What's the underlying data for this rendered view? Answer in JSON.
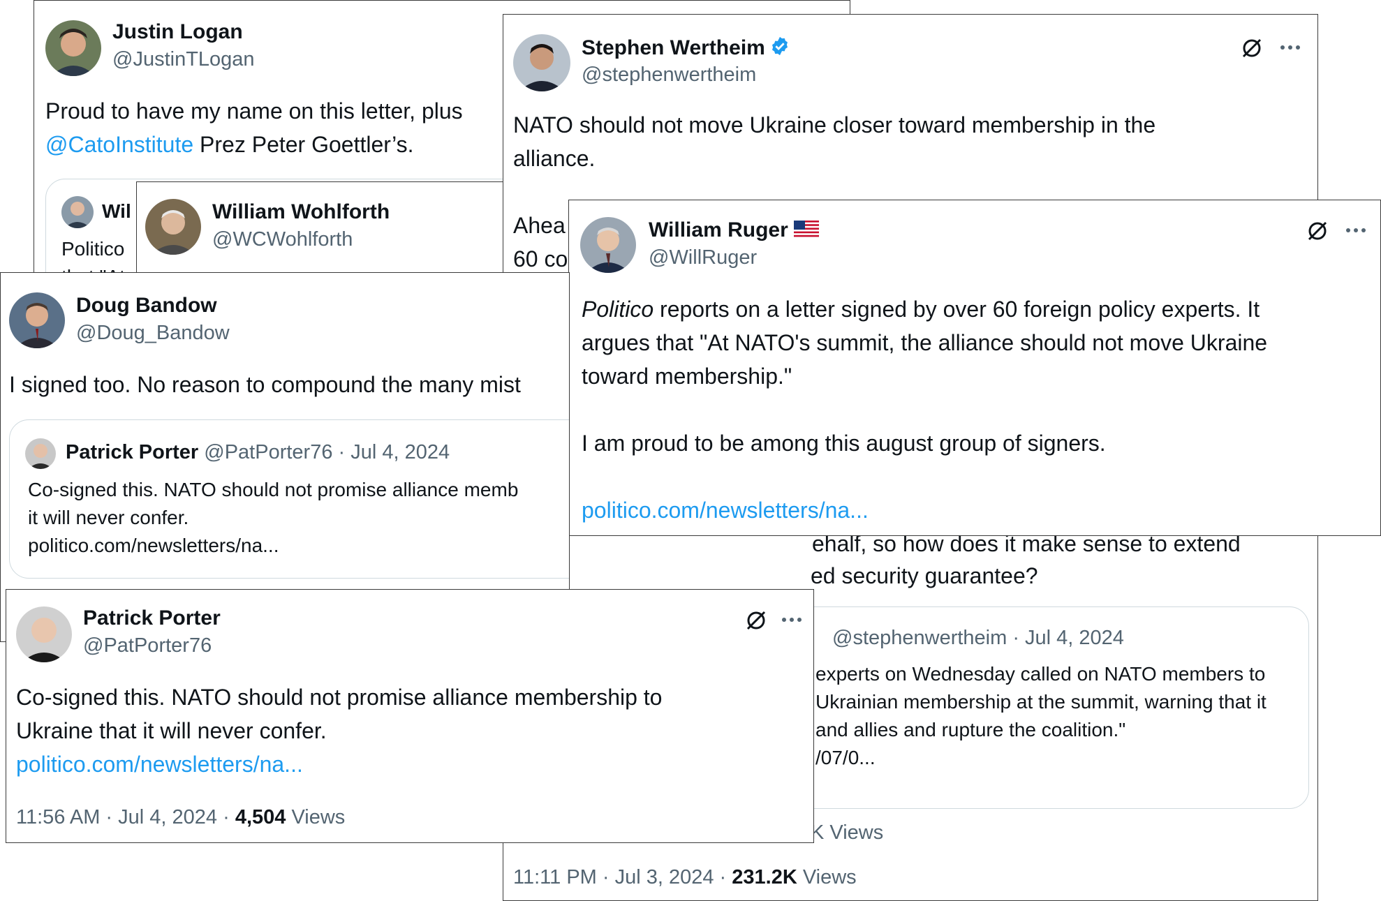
{
  "logan": {
    "name": "Justin Logan",
    "handle": "@JustinTLogan",
    "text_line1": "Proud to have my name on this letter, plus",
    "text_mention": "@CatoInstitute",
    "text_line2_rest": " Prez Peter Goettler’s.",
    "quote_name_partial": "Wil",
    "quote_text_partial": "Politico",
    "quote_text_partial2": "that \"At"
  },
  "wohlforth": {
    "name": "William Wohlforth",
    "handle": "@WCWohlforth"
  },
  "wertheim": {
    "name": "Stephen Wertheim",
    "handle": "@stephenwertheim",
    "text_line1": "NATO should not move Ukraine closer toward membership in the",
    "text_line2": "alliance.",
    "text_line3_partial": "Ahea",
    "text_line4_partial": "60 co",
    "text_line5_partial": "ehalf, so how does it make sense to extend",
    "text_line6_partial": "ed security guarantee?",
    "quote_handle_date": "@stephenwertheim · Jul 4, 2024",
    "quote_line1": "experts on Wednesday called on NATO members to",
    "quote_line2": "Ukrainian membership at the summit, warning that it",
    "quote_line3": "and allies and rupture the coalition.\"",
    "quote_line4": "/07/0...",
    "views_partial": "K Views",
    "time": "11:11 PM · Jul 3, 2024 · ",
    "views_count": "231.2K",
    "views_label": " Views"
  },
  "ruger": {
    "name": "William Ruger",
    "handle": "@WillRuger",
    "line1_italic": "Politico",
    "line1_rest": " reports on a letter signed by over 60 foreign policy experts. It",
    "line2": "argues that \"At NATO's summit, the alliance should not move Ukraine",
    "line3": "toward membership.\"",
    "line4": "I am proud to be among this august group of signers.",
    "link": "politico.com/newsletters/na..."
  },
  "bandow": {
    "name": "Doug Bandow",
    "handle": "@Doug_Bandow",
    "text": "I signed too. No reason to compound the many mist",
    "quote_name": "Patrick Porter",
    "quote_handle_date": " @PatPorter76 · Jul 4, 2024",
    "quote_line1": "Co-signed this. NATO should not promise alliance memb",
    "quote_line2": "it will never confer.",
    "quote_line3": "politico.com/newsletters/na..."
  },
  "porter": {
    "name": "Patrick Porter",
    "handle": "@PatPorter76",
    "line1": "Co-signed this. NATO should not promise alliance membership to",
    "line2": "Ukraine that it will never confer.",
    "link": "politico.com/newsletters/na...",
    "time": "11:56 AM · Jul 4, 2024 · ",
    "views_count": "4,504",
    "views_label": " Views"
  },
  "icons": [
    "grok-icon",
    "more-options-icon",
    "verified-badge-icon",
    "us-flag-icon"
  ],
  "colors": {
    "link": "#1d9bf0",
    "muted": "#536471",
    "text": "#0f1419",
    "verified": "#1d9bf0"
  }
}
